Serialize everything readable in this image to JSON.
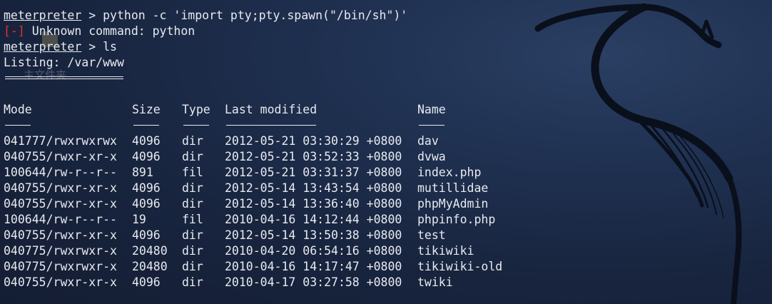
{
  "prompt": "meterpreter",
  "lines": {
    "cmd1_rest": " > python -c 'import pty;pty.spawn(\"/bin/sh\")'",
    "err_tag": "[-]",
    "err_msg": " Unknown command: python",
    "cmd2_rest": " > ls",
    "listing": "Listing: /var/www"
  },
  "watermark": "主文件夹",
  "table": {
    "headers": [
      "Mode",
      "Size",
      "Type",
      "Last modified",
      "Name"
    ],
    "rows": [
      [
        "041777/rwxrwxrwx",
        "4096",
        "dir",
        "2012-05-21 03:30:29 +0800",
        "dav"
      ],
      [
        "040755/rwxr-xr-x",
        "4096",
        "dir",
        "2012-05-21 03:52:33 +0800",
        "dvwa"
      ],
      [
        "100644/rw-r--r--",
        "891",
        "fil",
        "2012-05-21 03:31:37 +0800",
        "index.php"
      ],
      [
        "040755/rwxr-xr-x",
        "4096",
        "dir",
        "2012-05-14 13:43:54 +0800",
        "mutillidae"
      ],
      [
        "040755/rwxr-xr-x",
        "4096",
        "dir",
        "2012-05-14 13:36:40 +0800",
        "phpMyAdmin"
      ],
      [
        "100644/rw-r--r--",
        "19",
        "fil",
        "2010-04-16 14:12:44 +0800",
        "phpinfo.php"
      ],
      [
        "040755/rwxr-xr-x",
        "4096",
        "dir",
        "2012-05-14 13:50:38 +0800",
        "test"
      ],
      [
        "040775/rwxrwxr-x",
        "20480",
        "dir",
        "2010-04-20 06:54:16 +0800",
        "tikiwiki"
      ],
      [
        "040775/rwxrwxr-x",
        "20480",
        "dir",
        "2010-04-16 14:17:47 +0800",
        "tikiwiki-old"
      ],
      [
        "040755/rwxr-xr-x",
        "4096",
        "dir",
        "2010-04-17 03:27:58 +0800",
        "twiki"
      ]
    ]
  },
  "colors": {
    "text": "#e8eaf0",
    "error": "#e0312f",
    "background": "#1a2843"
  },
  "icons": [
    "kali-dragon-wallpaper-icon",
    "folder-icon"
  ]
}
